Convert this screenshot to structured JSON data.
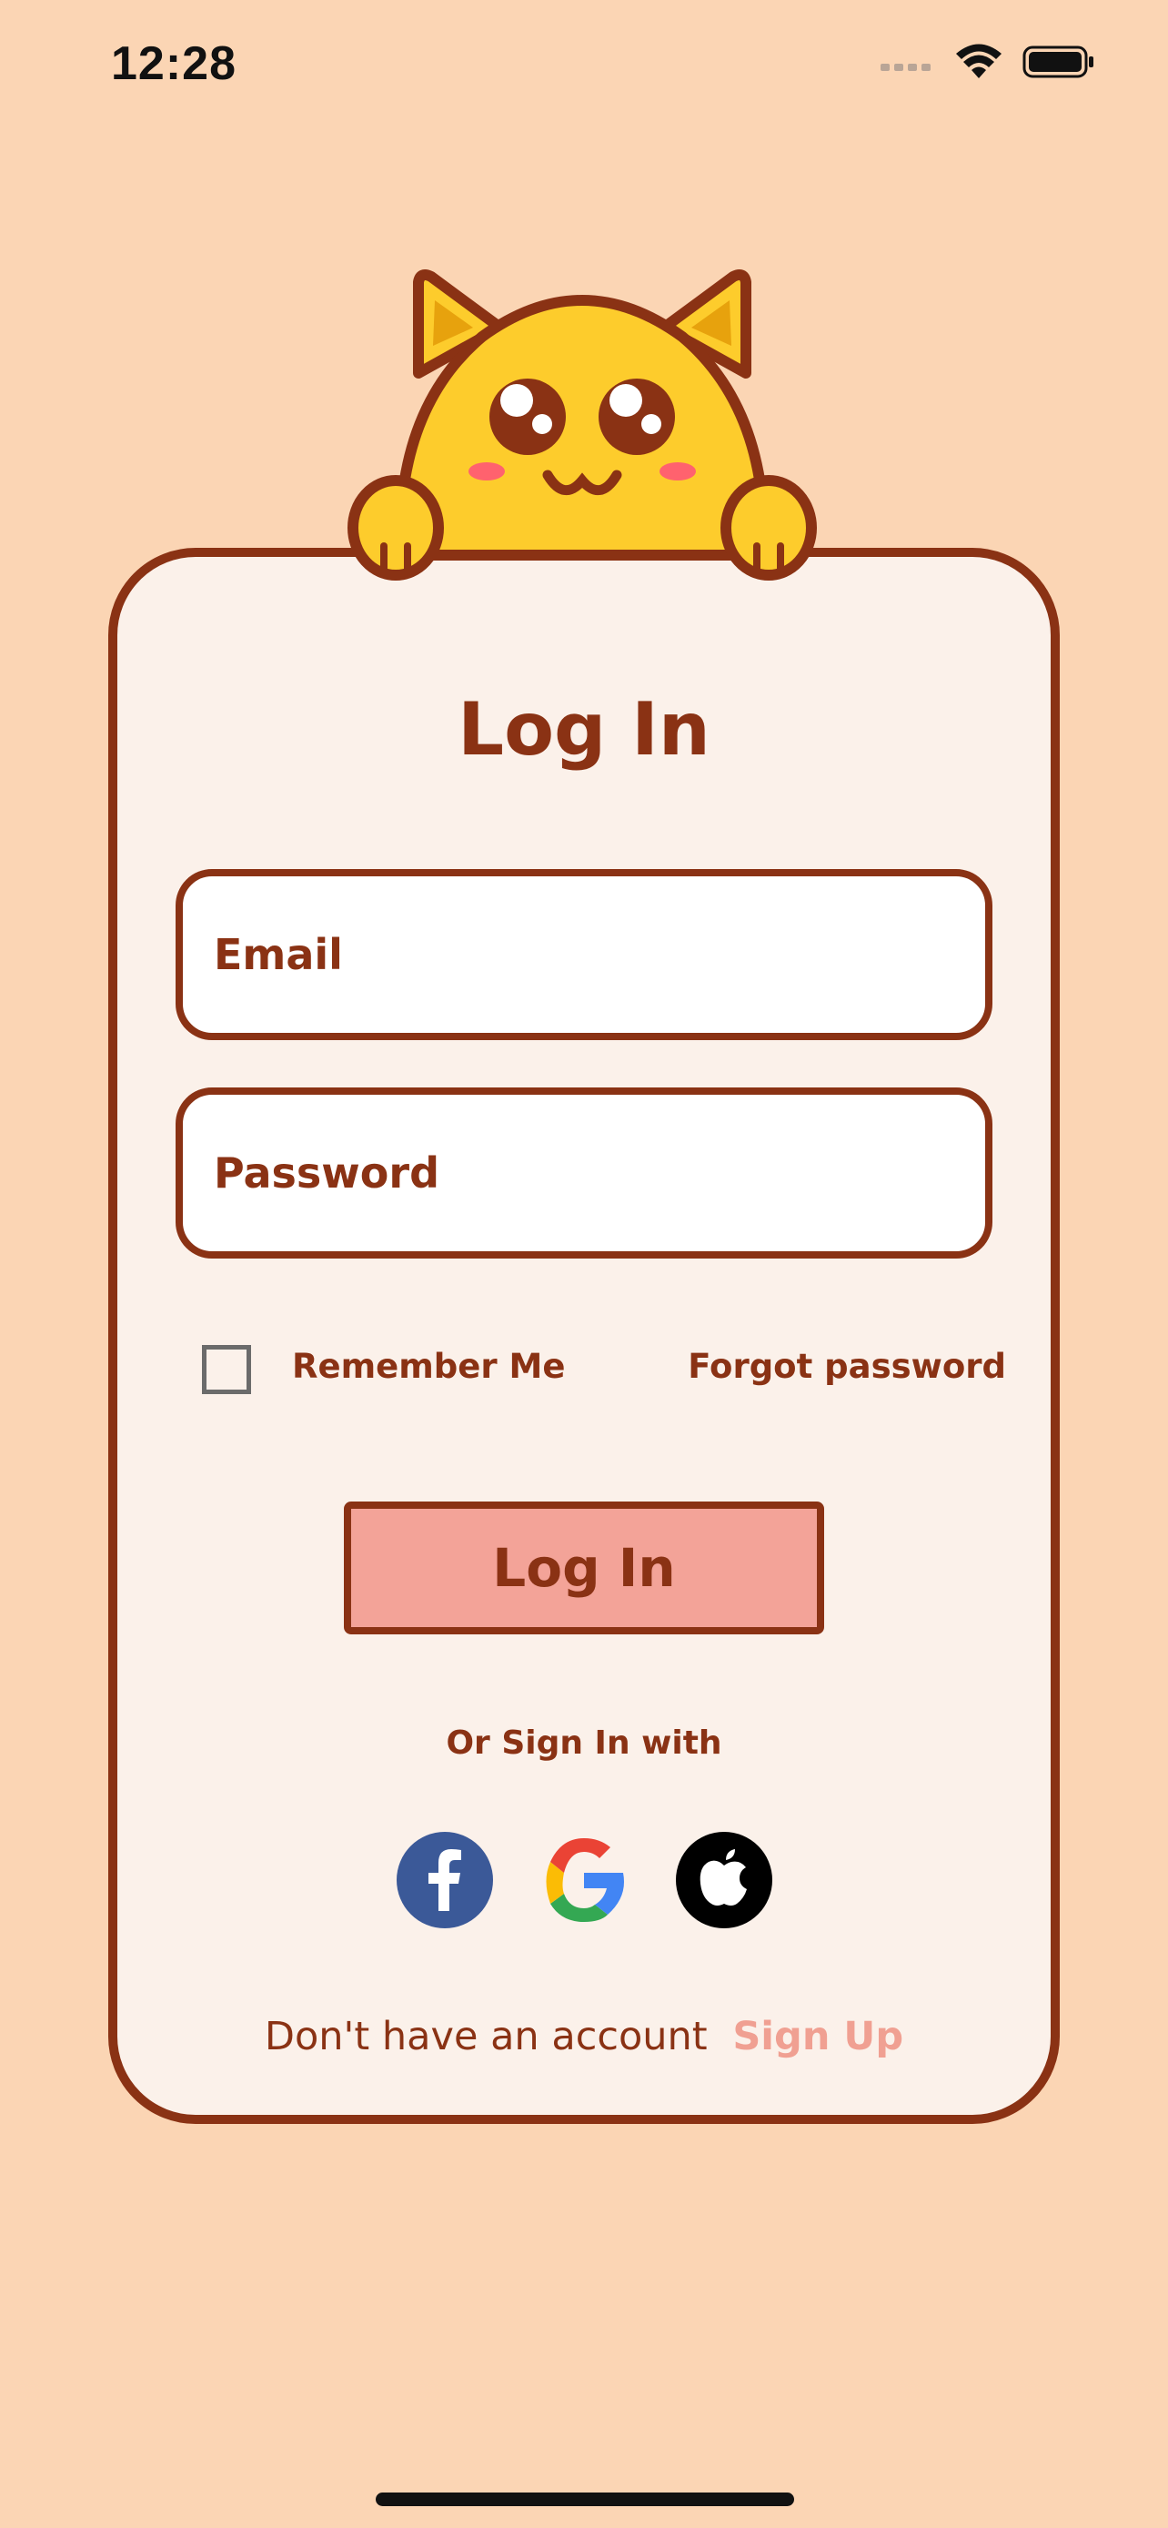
{
  "status_bar": {
    "time": "12:28",
    "icons": [
      "signal-icon",
      "wifi-icon",
      "battery-icon"
    ]
  },
  "login": {
    "title": "Log In",
    "email_placeholder": "Email",
    "password_placeholder": "Password",
    "remember_label": "Remember Me",
    "remember_checked": false,
    "forgot_label": "Forgot password",
    "button_label": "Log In",
    "or_text": "Or Sign In with",
    "social": [
      "facebook-icon",
      "google-icon",
      "apple-icon"
    ],
    "signup_prompt": "Don't have an account",
    "signup_link": "Sign Up"
  },
  "colors": {
    "background": "#fbd5b4",
    "card": "#fbf1ea",
    "accent": "#8a3214",
    "button": "#f3a398",
    "signup_link": "#f0a092",
    "mascot": "#fdcc2c"
  }
}
